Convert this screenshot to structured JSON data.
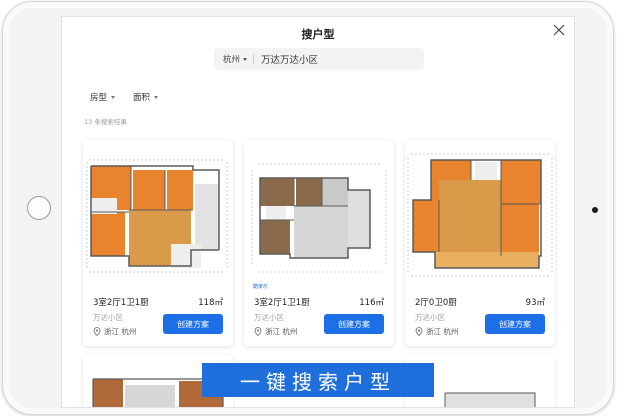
{
  "modal": {
    "title": "搜户型"
  },
  "search": {
    "city": "杭州",
    "query": "万达万达小区"
  },
  "filters": [
    {
      "label": "房型"
    },
    {
      "label": "面积"
    }
  ],
  "result_count": "13 条搜索结果",
  "cards": [
    {
      "title": "3室2厅1卫1厨",
      "area": "118㎡",
      "community": "万达小区",
      "location": "浙江 杭州",
      "button": "创建方案"
    },
    {
      "title": "3室2厅1卫1厨",
      "area": "116㎡",
      "community": "万达小区",
      "location": "浙江 杭州",
      "button": "创建方案",
      "watermark": "酷家乐"
    },
    {
      "title": "2厅0卫0厨",
      "area": "93㎡",
      "community": "万达小区",
      "location": "浙江 杭州",
      "button": "创建方案"
    }
  ],
  "banner": {
    "text": "一键搜索户型"
  },
  "colors": {
    "accent": "#1d6fe8",
    "room_orange": "#e8832e",
    "room_wood": "#d99a4a",
    "wall": "#5a5a5a"
  }
}
